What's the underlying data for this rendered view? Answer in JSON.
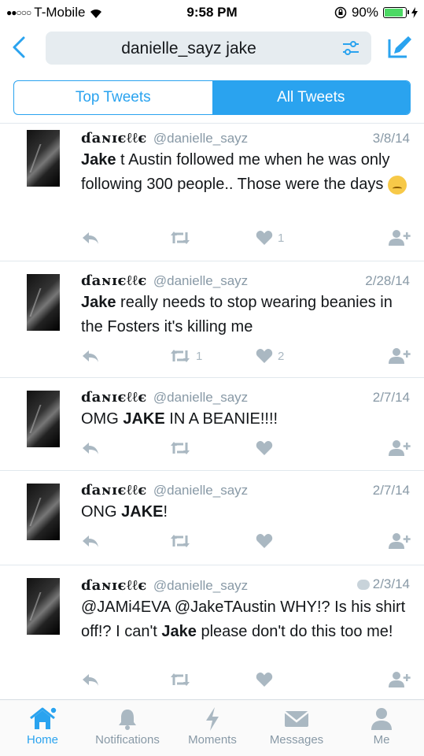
{
  "status": {
    "carrier": "T-Mobile",
    "time": "9:58 PM",
    "battery": "90%",
    "battery_level": 0.9
  },
  "search": {
    "query": "danielle_sayz jake"
  },
  "tabs": [
    {
      "label": "Top Tweets",
      "active": false
    },
    {
      "label": "All Tweets",
      "active": true
    }
  ],
  "tweets": [
    {
      "name": "ɗaɴɪєℓℓє",
      "handle": "@danielle_sayz",
      "date": "3/8/14",
      "text_bold": "Jake",
      "text_rest": " t Austin followed me when he was only following 300 people.. Those were the days ",
      "emoji": "pensive-face-emoji",
      "retweets": "",
      "likes": "1"
    },
    {
      "name": "ɗaɴɪєℓℓє",
      "handle": "@danielle_sayz",
      "date": "2/28/14",
      "text_bold": "Jake",
      "text_rest": " really needs to stop wearing beanies in the Fosters it's killing me",
      "retweets": "1",
      "likes": "2"
    },
    {
      "name": "ɗaɴɪєℓℓє",
      "handle": "@danielle_sayz",
      "date": "2/7/14",
      "text_pre": "OMG ",
      "text_bold": "JAKE",
      "text_rest": " IN A BEANIE!!!!",
      "retweets": "",
      "likes": ""
    },
    {
      "name": "ɗaɴɪєℓℓє",
      "handle": "@danielle_sayz",
      "date": "2/7/14",
      "text_pre": "ONG ",
      "text_bold": "JAKE",
      "text_rest": "!",
      "retweets": "",
      "likes": ""
    },
    {
      "name": "ɗaɴɪєℓℓє",
      "handle": "@danielle_sayz",
      "date": "2/3/14",
      "text_pre": "@JAMi4EVA @JakeTAustin WHY!? Is his shirt off!? I can't ",
      "text_bold": "Jake",
      "text_rest": " please don't do this too me!",
      "retweets": "",
      "likes": ""
    }
  ],
  "nav": [
    {
      "label": "Home",
      "icon": "home-icon",
      "active": true
    },
    {
      "label": "Notifications",
      "icon": "bell-icon",
      "active": false
    },
    {
      "label": "Moments",
      "icon": "lightning-icon",
      "active": false
    },
    {
      "label": "Messages",
      "icon": "envelope-icon",
      "active": false
    },
    {
      "label": "Me",
      "icon": "person-icon",
      "active": false
    }
  ],
  "colors": {
    "accent": "#2aa3ef",
    "muted": "#8899a6",
    "icon_gray": "#aab8c2",
    "divider": "#e1e8ed",
    "battery": "#4cd964"
  }
}
